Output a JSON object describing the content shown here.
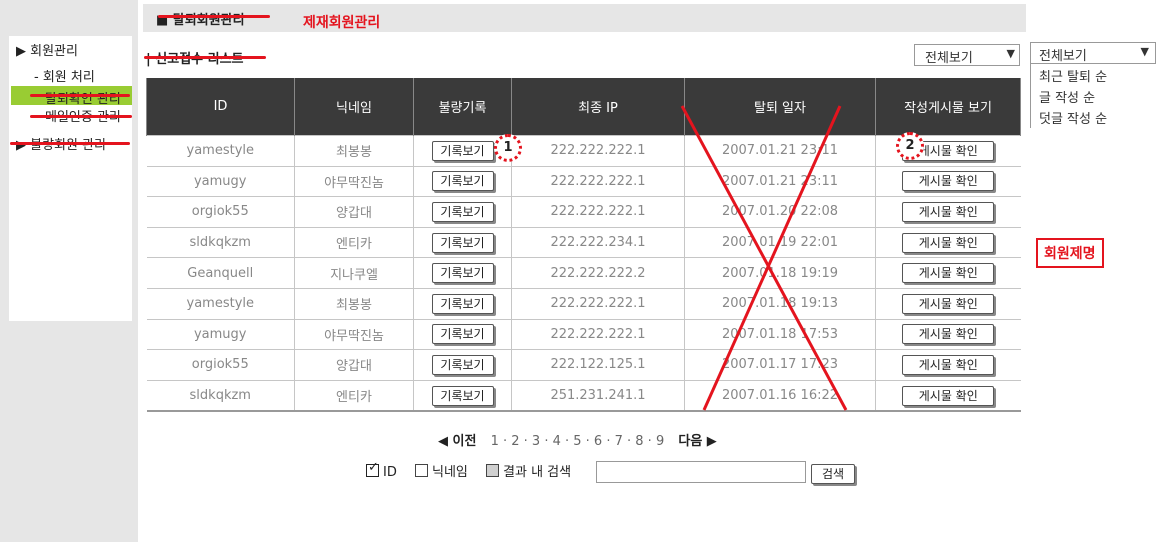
{
  "sidebar": {
    "items": [
      {
        "label": "▶ 회원관리"
      },
      {
        "label": "- 회원 처리"
      },
      {
        "label": "탈퇴확인 관리"
      },
      {
        "label": "메일인증 관리"
      },
      {
        "label": "▶ 불량회원 관리"
      }
    ]
  },
  "header": {
    "title": "■ 탈퇴회원관리",
    "annotation": "제재회원관리"
  },
  "section": {
    "title": "| 신고접수 리스트"
  },
  "filter": {
    "selected": "전체보기",
    "arrow": "▼",
    "dropdown_selected": "전체보기",
    "options": [
      "최근 탈퇴 순",
      "글 작성 순",
      "덧글 작성 순"
    ]
  },
  "table": {
    "headers": [
      "ID",
      "닉네임",
      "불량기록",
      "최종 IP",
      "탈퇴 일자",
      "작성게시물 보기"
    ],
    "record_button_label": "기록보기",
    "post_button_label": "게시물 확인",
    "rows": [
      {
        "id": "yamestyle",
        "nick": "최봉봉",
        "ip": "222.222.222.1",
        "date": "2007.01.21 23:11"
      },
      {
        "id": "yamugy",
        "nick": "야무딱진놈",
        "ip": "222.222.222.1",
        "date": "2007.01.21 23:11"
      },
      {
        "id": "orgiok55",
        "nick": "양갑대",
        "ip": "222.222.222.1",
        "date": "2007.01.20 22:08"
      },
      {
        "id": "sldkqkzm",
        "nick": "엔티카",
        "ip": "222.222.234.1",
        "date": "2007.01.19 22:01"
      },
      {
        "id": "Geanquell",
        "nick": "지나쿠엘",
        "ip": "222.222.222.2",
        "date": "2007.01.18 19:19"
      },
      {
        "id": "yamestyle",
        "nick": "최봉봉",
        "ip": "222.222.222.1",
        "date": "2007.01.18 19:13"
      },
      {
        "id": "yamugy",
        "nick": "야무딱진놈",
        "ip": "222.222.222.1",
        "date": "2007.01.18 17:53"
      },
      {
        "id": "orgiok55",
        "nick": "양갑대",
        "ip": "222.122.125.1",
        "date": "2007.01.17 17:23"
      },
      {
        "id": "sldkqkzm",
        "nick": "엔티카",
        "ip": "251.231.241.1",
        "date": "2007.01.16 16:22"
      }
    ]
  },
  "markers": {
    "one": "1",
    "two": "2"
  },
  "member_ban_label": "회원제명",
  "pagination": {
    "prev": "◀ 이전",
    "pages": "1 · 2 · 3 · 4 · 5 · 6 · 7 · 8 · 9",
    "next": "다음 ▶"
  },
  "search": {
    "options": [
      "ID",
      "닉네임",
      "결과 내 검색"
    ],
    "input_value": "",
    "button_label": "검색"
  },
  "colors": {
    "accent_red": "#e4141e",
    "header_dark": "#3a3a3a",
    "highlight_green": "#99cc33"
  }
}
